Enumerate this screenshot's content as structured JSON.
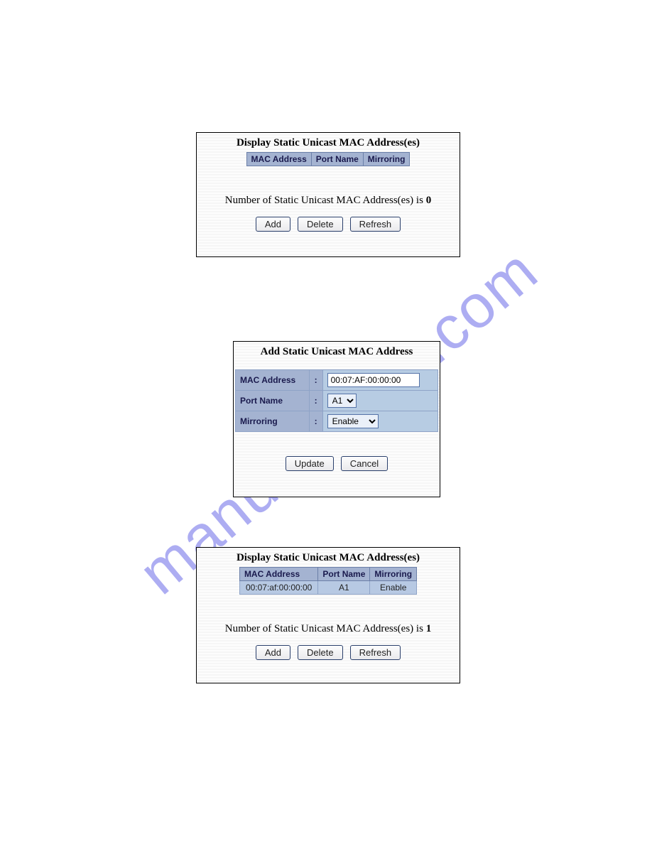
{
  "watermark": "manualshive.com",
  "panel1": {
    "title": "Display Static Unicast MAC Address(es)",
    "headers": {
      "mac": "MAC Address",
      "port": "Port Name",
      "mirror": "Mirroring"
    },
    "count_prefix": "Number of Static Unicast MAC Address(es) is ",
    "count_value": "0",
    "buttons": {
      "add": "Add",
      "delete": "Delete",
      "refresh": "Refresh"
    }
  },
  "panel2": {
    "title": "Add Static Unicast MAC Address",
    "fields": {
      "mac_label": "MAC Address",
      "mac_value": "00:07:AF:00:00:00",
      "port_label": "Port Name",
      "port_value": "A1",
      "mirror_label": "Mirroring",
      "mirror_value": "Enable"
    },
    "buttons": {
      "update": "Update",
      "cancel": "Cancel"
    }
  },
  "panel3": {
    "title": "Display Static Unicast MAC Address(es)",
    "headers": {
      "mac": "MAC Address",
      "port": "Port Name",
      "mirror": "Mirroring"
    },
    "row": {
      "mac": "00:07:af:00:00:00",
      "port": "A1",
      "mirror": "Enable"
    },
    "count_prefix": "Number of Static Unicast MAC Address(es) is ",
    "count_value": "1",
    "buttons": {
      "add": "Add",
      "delete": "Delete",
      "refresh": "Refresh"
    }
  }
}
